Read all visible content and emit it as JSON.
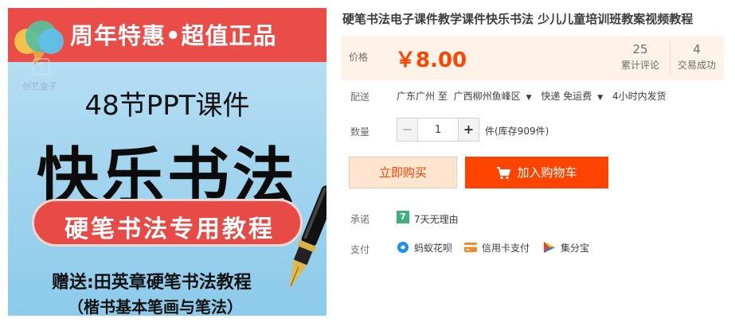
{
  "product_image": {
    "banner_text": "周年特惠•超值正品",
    "logo_caption": "创艺盒子",
    "lessons": "48节PPT课件",
    "big_title": "快乐书法",
    "pill_text": "硬笔书法专用教程",
    "gift_line1": "赠送:田英章硬笔书法教程",
    "gift_line2": "（楷书基本笔画与笔法）"
  },
  "product": {
    "title": "硬笔书法电子课件教学课件快乐书法 少儿儿童培训班教案视频教程"
  },
  "price": {
    "label": "价格",
    "value": "￥8.00",
    "reviews_count": "25",
    "reviews_label": "累计评论",
    "sales_count": "4",
    "sales_label": "交易成功"
  },
  "delivery": {
    "label": "配送",
    "from": "广东广州 至",
    "to": "广西柳州鱼峰区",
    "method": "快递 免运费",
    "ship_time": "4小时内发货"
  },
  "quantity": {
    "label": "数量",
    "value": "1",
    "stock": "件(库存909件)"
  },
  "actions": {
    "buy_now": "立即购买",
    "add_to_cart": "加入购物车"
  },
  "promise": {
    "label": "承诺",
    "icon_text": "7",
    "text": "7天无理由"
  },
  "payment": {
    "label": "支付",
    "methods": [
      "蚂蚁花呗",
      "信用卡支付",
      "集分宝"
    ]
  },
  "colors": {
    "price": "#ff4400",
    "price_bg": "#fff2e8",
    "cart_button": "#ff4400",
    "buy_now_bg": "#ffe4d0"
  }
}
